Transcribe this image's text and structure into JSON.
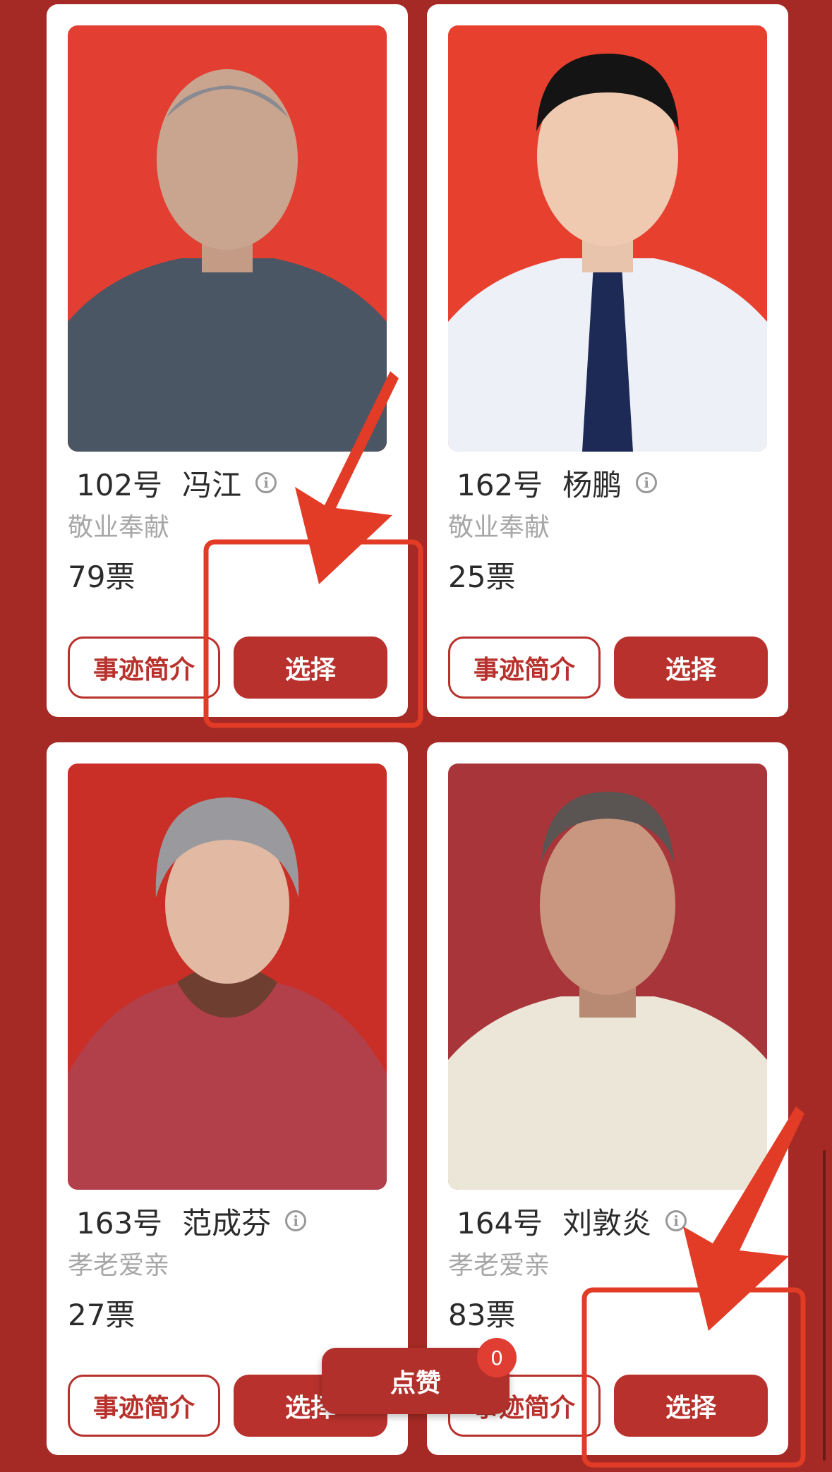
{
  "candidates": [
    {
      "number": "102号",
      "name": "冯江",
      "category": "敬业奉献",
      "votes": "79票",
      "story_label": "事迹简介",
      "select_label": "选择",
      "photo_bg": "#e23e31",
      "shirt_color": "#4a5663"
    },
    {
      "number": "162号",
      "name": "杨鹏",
      "category": "敬业奉献",
      "votes": "25票",
      "story_label": "事迹简介",
      "select_label": "选择",
      "photo_bg": "#e8402f",
      "shirt_color": "#eef0f7"
    },
    {
      "number": "163号",
      "name": "范成芬",
      "category": "孝老爱亲",
      "votes": "27票",
      "story_label": "事迹简介",
      "select_label": "选择",
      "photo_bg": "#c92f27",
      "shirt_color": "#b2404a"
    },
    {
      "number": "164号",
      "name": "刘敦炎",
      "category": "孝老爱亲",
      "votes": "83票",
      "story_label": "事迹简介",
      "select_label": "选择",
      "photo_bg": "#a8353a",
      "shirt_color": "#ece6d8"
    }
  ],
  "like": {
    "label": "点赞",
    "count": "0"
  },
  "colors": {
    "page_bg": "#a52a25",
    "accent": "#b8312c",
    "annotation": "#e23b26"
  }
}
